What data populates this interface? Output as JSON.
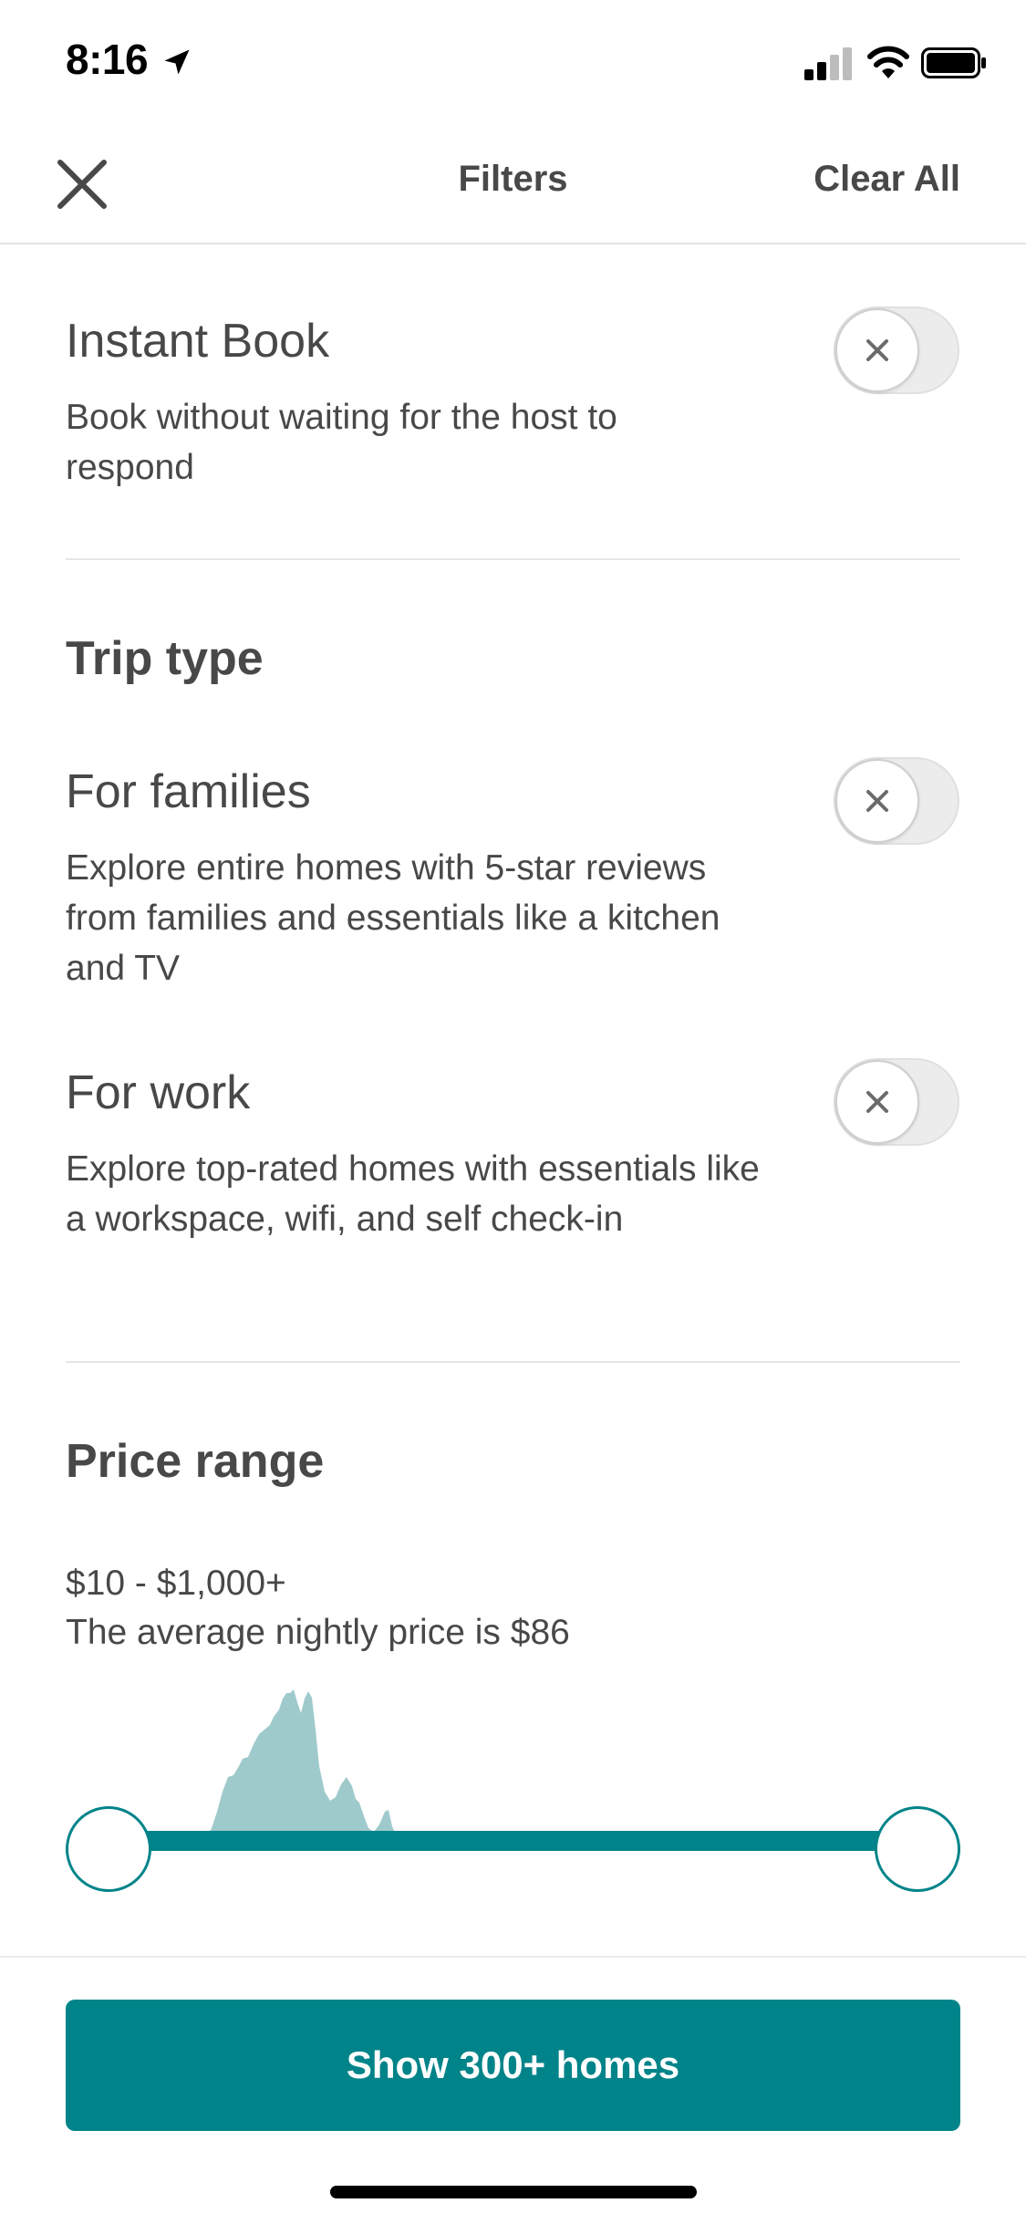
{
  "status_bar": {
    "time": "8:16"
  },
  "nav": {
    "title": "Filters",
    "clear_all": "Clear All"
  },
  "instant_book": {
    "title": "Instant Book",
    "description": "Book without waiting for the host to respond",
    "enabled": false
  },
  "trip_type": {
    "heading": "Trip type",
    "items": [
      {
        "title": "For families",
        "description": "Explore entire homes with 5-star reviews from families and essentials like a kitchen and TV",
        "enabled": false
      },
      {
        "title": "For work",
        "description": "Explore top-rated homes with essentials like a workspace, wifi, and self check-in",
        "enabled": false
      }
    ]
  },
  "price_range": {
    "heading": "Price range",
    "range_text": "$10 - $1,000+",
    "average_text": "The average nightly price is $86",
    "selected_min_fraction": 0.0,
    "selected_max_fraction": 1.0
  },
  "cta": {
    "label": "Show 300+ homes"
  },
  "colors": {
    "accent": "#008489",
    "histogram_fill": "#9fcacc",
    "text": "#484848"
  }
}
